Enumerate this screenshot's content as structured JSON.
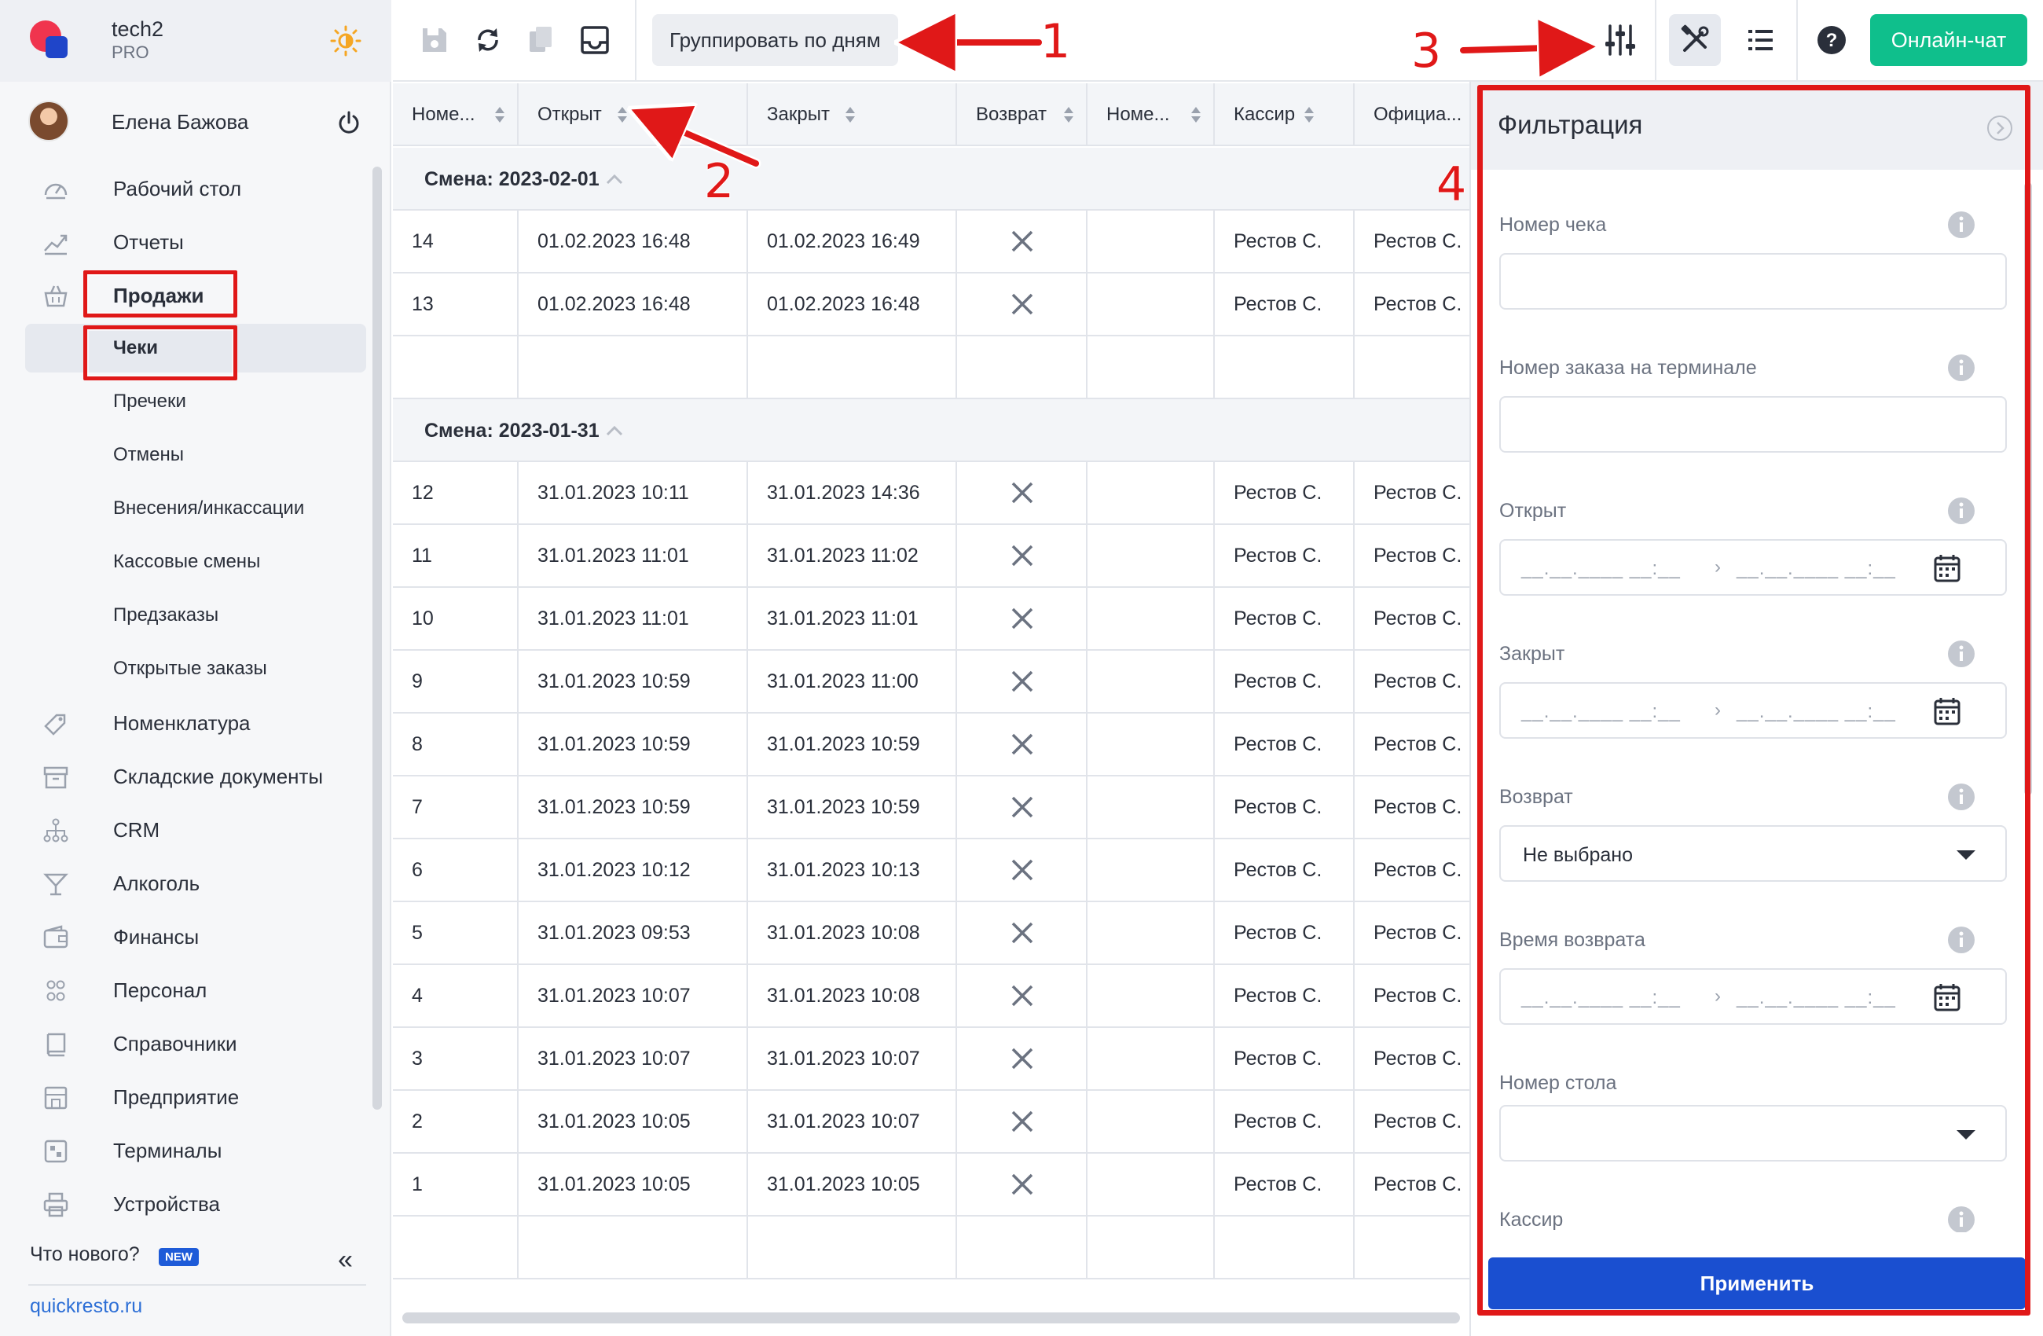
{
  "brand": {
    "name": "tech2",
    "plan": "PRO"
  },
  "user": {
    "name": "Елена Бажова"
  },
  "nav": {
    "items": [
      {
        "label": "Рабочий стол",
        "icon": "dashboard-icon"
      },
      {
        "label": "Отчеты",
        "icon": "reports-chart-icon"
      },
      {
        "label": "Продажи",
        "icon": "basket-icon"
      },
      {
        "label": "Чеки",
        "icon": ""
      },
      {
        "label": "Пречеки",
        "icon": ""
      },
      {
        "label": "Отмены",
        "icon": ""
      },
      {
        "label": "Внесения/инкассации",
        "icon": ""
      },
      {
        "label": "Кассовые смены",
        "icon": ""
      },
      {
        "label": "Предзаказы",
        "icon": ""
      },
      {
        "label": "Открытые заказы",
        "icon": ""
      },
      {
        "label": "Номенклатура",
        "icon": "tag-icon"
      },
      {
        "label": "Складские документы",
        "icon": "archive-icon"
      },
      {
        "label": "CRM",
        "icon": "hierarchy-icon"
      },
      {
        "label": "Алкоголь",
        "icon": "cocktail-icon"
      },
      {
        "label": "Финансы",
        "icon": "wallet-icon"
      },
      {
        "label": "Персонал",
        "icon": "people-icon"
      },
      {
        "label": "Справочники",
        "icon": "book-icon"
      },
      {
        "label": "Предприятие",
        "icon": "building-icon"
      },
      {
        "label": "Терминалы",
        "icon": "qr-terminal-icon"
      },
      {
        "label": "Устройства",
        "icon": "printer-icon"
      }
    ]
  },
  "footer": {
    "whats_new": "Что нового?",
    "new_badge": "NEW",
    "site": "quickresto.ru"
  },
  "toolbar": {
    "group_label": "Группировать по дням",
    "chat_label": "Онлайн-чат"
  },
  "table": {
    "columns": [
      "Номе...",
      "Открыт",
      "Закрыт",
      "Возврат",
      "Номе...",
      "Кассир",
      "Официа..."
    ],
    "groups": [
      {
        "label": "Смена: 2023-02-01",
        "rows": [
          {
            "num": "14",
            "opened": "01.02.2023 16:48",
            "closed": "01.02.2023 16:49",
            "cashier": "Рестов С.",
            "official": "Рестов С."
          },
          {
            "num": "13",
            "opened": "01.02.2023 16:48",
            "closed": "01.02.2023 16:48",
            "cashier": "Рестов С.",
            "official": "Рестов С."
          }
        ]
      },
      {
        "label": "Смена: 2023-01-31",
        "rows": [
          {
            "num": "12",
            "opened": "31.01.2023 10:11",
            "closed": "31.01.2023 14:36",
            "cashier": "Рестов С.",
            "official": "Рестов С."
          },
          {
            "num": "11",
            "opened": "31.01.2023 11:01",
            "closed": "31.01.2023 11:02",
            "cashier": "Рестов С.",
            "official": "Рестов С."
          },
          {
            "num": "10",
            "opened": "31.01.2023 11:01",
            "closed": "31.01.2023 11:01",
            "cashier": "Рестов С.",
            "official": "Рестов С."
          },
          {
            "num": "9",
            "opened": "31.01.2023 10:59",
            "closed": "31.01.2023 11:00",
            "cashier": "Рестов С.",
            "official": "Рестов С."
          },
          {
            "num": "8",
            "opened": "31.01.2023 10:59",
            "closed": "31.01.2023 10:59",
            "cashier": "Рестов С.",
            "official": "Рестов С."
          },
          {
            "num": "7",
            "opened": "31.01.2023 10:59",
            "closed": "31.01.2023 10:59",
            "cashier": "Рестов С.",
            "official": "Рестов С."
          },
          {
            "num": "6",
            "opened": "31.01.2023 10:12",
            "closed": "31.01.2023 10:13",
            "cashier": "Рестов С.",
            "official": "Рестов С."
          },
          {
            "num": "5",
            "opened": "31.01.2023 09:53",
            "closed": "31.01.2023 10:08",
            "cashier": "Рестов С.",
            "official": "Рестов С."
          },
          {
            "num": "4",
            "opened": "31.01.2023 10:07",
            "closed": "31.01.2023 10:08",
            "cashier": "Рестов С.",
            "official": "Рестов С."
          },
          {
            "num": "3",
            "opened": "31.01.2023 10:07",
            "closed": "31.01.2023 10:07",
            "cashier": "Рестов С.",
            "official": "Рестов С."
          },
          {
            "num": "2",
            "opened": "31.01.2023 10:05",
            "closed": "31.01.2023 10:07",
            "cashier": "Рестов С.",
            "official": "Рестов С."
          },
          {
            "num": "1",
            "opened": "31.01.2023 10:05",
            "closed": "31.01.2023 10:05",
            "cashier": "Рестов С.",
            "official": "Рестов С."
          }
        ]
      }
    ]
  },
  "filter": {
    "title": "Фильтрация",
    "receipt_number_label": "Номер чека",
    "terminal_order_label": "Номер заказа на терминале",
    "opened_label": "Открыт",
    "closed_label": "Закрыт",
    "refund_label": "Возврат",
    "refund_value": "Не выбрано",
    "refund_time_label": "Время возврата",
    "table_number_label": "Номер стола",
    "cashier_label": "Кассир",
    "date_placeholder": "__.__.____ __:__",
    "apply_label": "Применить"
  },
  "annotations": [
    "1",
    "2",
    "3",
    "4"
  ],
  "colors": {
    "accent": "#1a4fd0",
    "chat": "#0fbf8c",
    "annotation": "#e01818"
  }
}
